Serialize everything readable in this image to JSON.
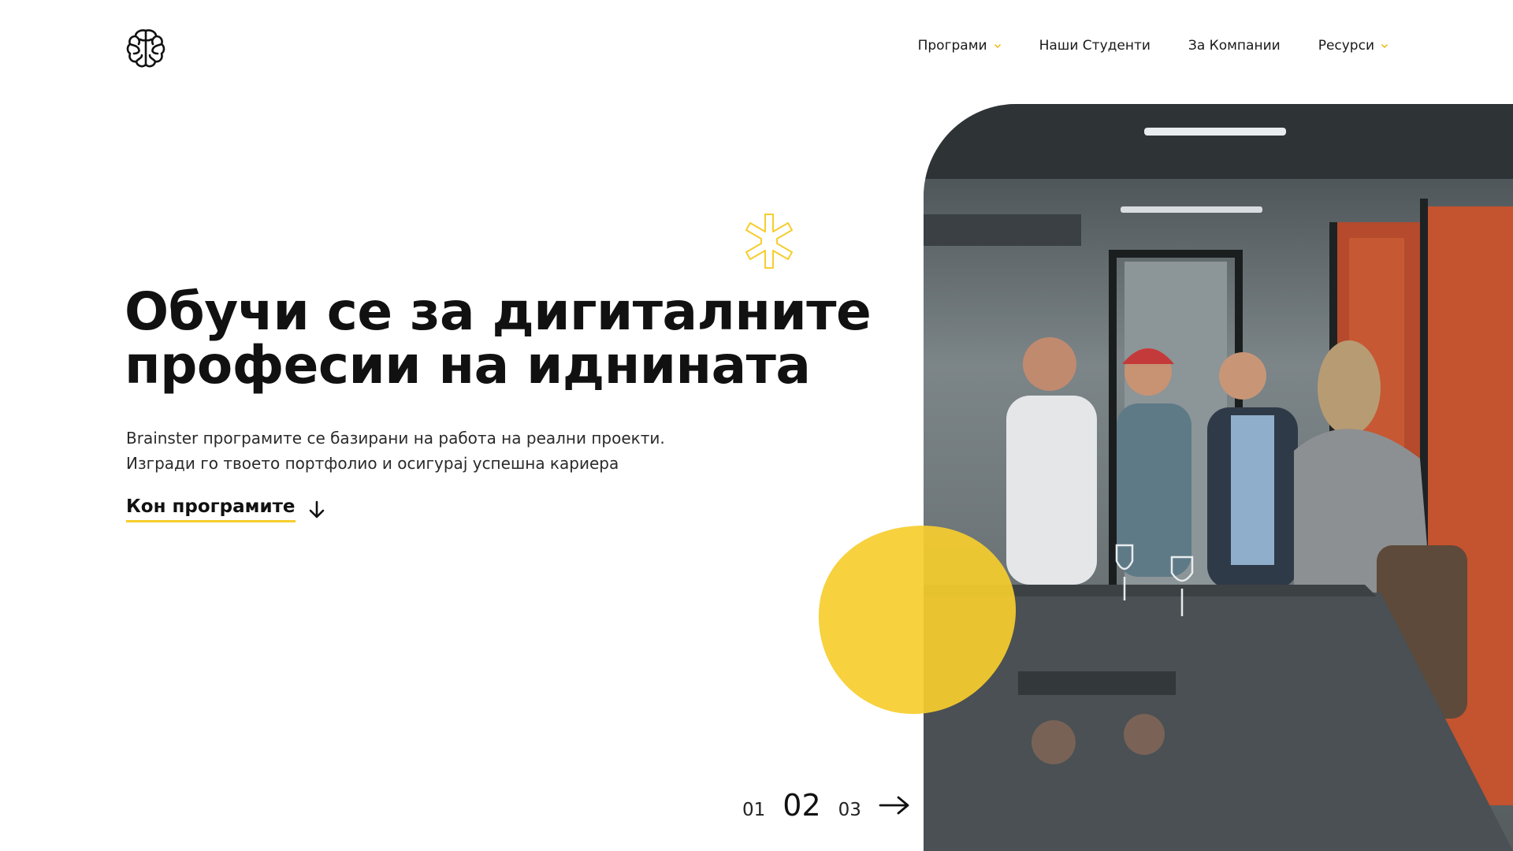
{
  "nav": {
    "items": [
      {
        "label": "Програми",
        "has_dropdown": true
      },
      {
        "label": "Наши Студенти",
        "has_dropdown": false
      },
      {
        "label": "За Компании",
        "has_dropdown": false
      },
      {
        "label": "Ресурси",
        "has_dropdown": true
      }
    ]
  },
  "hero": {
    "headline_line1": "Обучи се за дигиталните",
    "headline_line2": "професии на иднината",
    "sub_line1": "Brainster програмите се базирани на работа на реални проекти.",
    "sub_line2": "Изгради го твоето портфолио и осигурај успешна кариера",
    "cta_label": "Кон програмите"
  },
  "pager": {
    "pages": [
      "01",
      "02",
      "03"
    ],
    "active": "02"
  },
  "colors": {
    "accent": "#f6cd2e",
    "text": "#111111",
    "chevron": "#f0b400"
  },
  "icons": {
    "logo": "brain-logo-icon",
    "decoration": "asterisk-icon",
    "cta": "arrow-down-icon",
    "pager_next": "arrow-right-icon",
    "dropdown": "chevron-down-icon"
  }
}
